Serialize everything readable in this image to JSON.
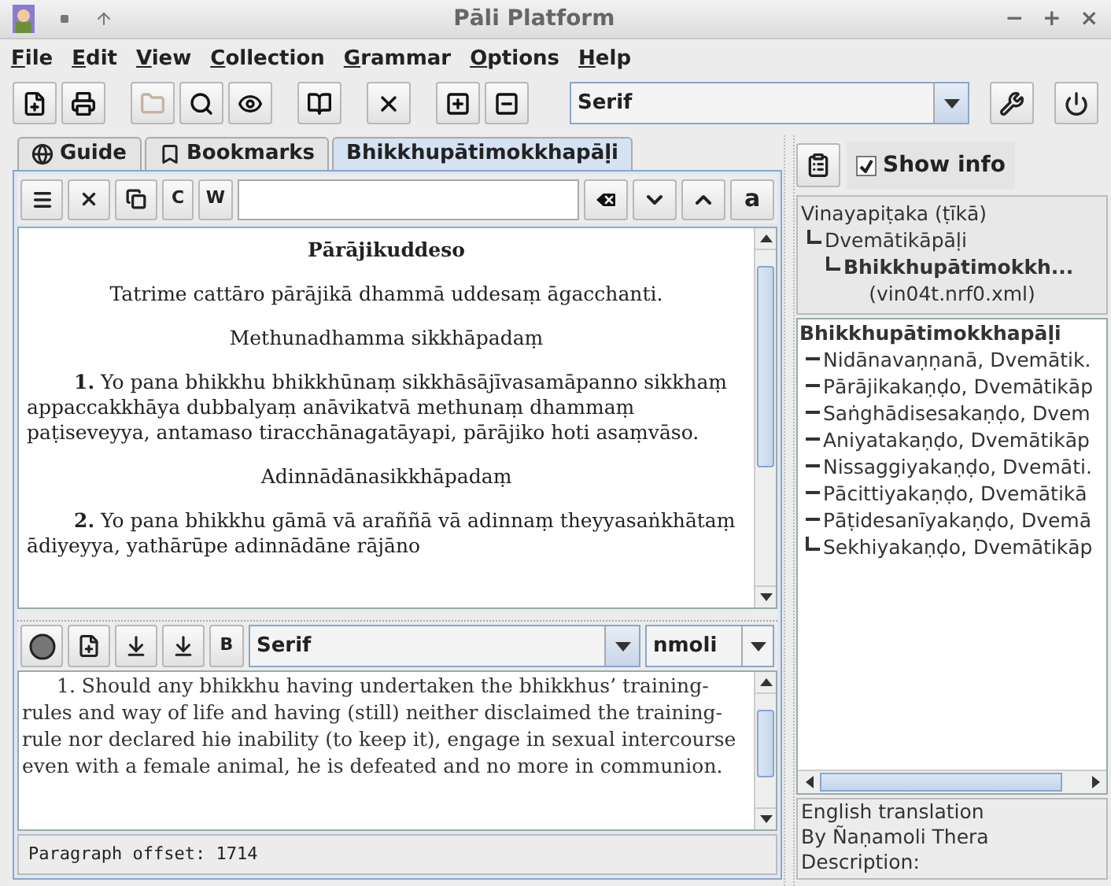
{
  "window": {
    "title": "Pāli Platform",
    "controls": [
      "−",
      "+",
      "×"
    ]
  },
  "menu": [
    {
      "label": "File"
    },
    {
      "label": "Edit"
    },
    {
      "label": "View"
    },
    {
      "label": "Collection"
    },
    {
      "label": "Grammar"
    },
    {
      "label": "Options"
    },
    {
      "label": "Help"
    }
  ],
  "toolbar": {
    "buttons": [
      {
        "disabled": false
      },
      {
        "disabled": false
      },
      {
        "disabled": true
      },
      {
        "disabled": false
      },
      {
        "disabled": false
      },
      {
        "disabled": false
      },
      {
        "disabled": false
      },
      {
        "disabled": false
      },
      {
        "disabled": false
      }
    ],
    "font": "Serif"
  },
  "tabs": [
    {
      "label": "Guide",
      "selected": false
    },
    {
      "label": "Bookmarks",
      "selected": false
    },
    {
      "label": "Bhikkhupātimokkhapāḷi",
      "selected": true
    }
  ],
  "find_bar": {
    "case_button": "C",
    "word_button": "W",
    "accent_button": "a"
  },
  "content": [
    {
      "kind": "title",
      "text": "Pārājikuddeso"
    },
    {
      "kind": "center",
      "text": "Tatrime cattāro pārājikā dhammā uddesaṃ āgacchanti."
    },
    {
      "kind": "center",
      "text": "Methunadhamma sikkhāpadaṃ"
    },
    {
      "kind": "para",
      "number": "1.",
      "text": "Yo pana bhikkhu bhikkhūnaṃ sikkhāsājīvasamāpanno sikkhaṃ appaccakkhāya dubbalyaṃ anāvikatvā methunaṃ dhammaṃ paṭiseveyya, antamaso tiracchānagatāyapi, pārājiko hoti asaṃvāso."
    },
    {
      "kind": "center",
      "text": "Adinnādānasikkhāpadaṃ"
    },
    {
      "kind": "para",
      "number": "2.",
      "text": "Yo pana bhikkhu gāmā vā araññā vā adinnaṃ theyyasaṅkhātaṃ ādiyeyya, yathārūpe adinnādāne rājāno"
    }
  ],
  "translation_bar": {
    "bold_button": "B",
    "font": "Serif",
    "translator": "nmoli"
  },
  "translation": "1. Should any bhikkhu having undertaken the bhikkhus’ training-rules and way of life and having (still) neither disclaimed the training-rule nor declared hiѳ inability (to keep it), engage in sexual intercourse even with a female animal, he is defeated and no more in communion.",
  "status_bar": "Paragraph offset: 1714",
  "show_info": {
    "label": "Show info",
    "checked": true
  },
  "info_tree": [
    {
      "label": "Vinayapiṭaka (ṭīkā)",
      "children": [
        {
          "label": "Dvemātikāpāḷi",
          "children": [
            {
              "label": "Bhikkhupātimokkh..."
            }
          ]
        }
      ]
    }
  ],
  "file_name": "(vin04t.nrf0.xml)",
  "toc": [
    {
      "label": "Bhikkhupātimokkhapāḷi",
      "children": [
        {
          "label": "Nidānavaṇṇanā, Dvemātik."
        },
        {
          "label": "Pārājikakaṇḍo, Dvemātikāp"
        },
        {
          "label": "Saṅghādisesakaṇḍo, Dvem"
        },
        {
          "label": "Aniyatakaṇḍo, Dvemātikāp"
        },
        {
          "label": "Nissaggiyakaṇḍo, Dvemāti."
        },
        {
          "label": "Pācittiyakaṇḍo, Dvemātikā"
        },
        {
          "label": "Pāṭidesanīyakaṇḍo, Dvemā"
        },
        {
          "label": "Sekhiyakaṇḍo, Dvemātikāp"
        }
      ]
    }
  ],
  "description": [
    "English translation",
    "By Ñaṇamoli Thera",
    "Description:"
  ]
}
